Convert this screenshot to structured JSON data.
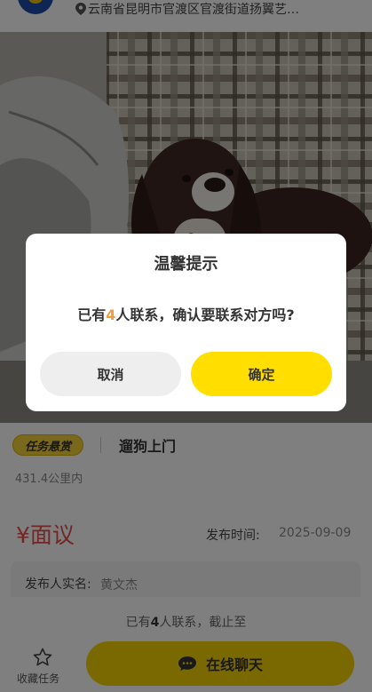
{
  "header": {
    "location": "云南省昆明市官渡区官渡街道扬翼艺…"
  },
  "task": {
    "badge": "任务悬赏",
    "title": "遛狗上门",
    "distance": "431.4公里内",
    "price": "¥面议",
    "publish_label": "发布时间:",
    "publish_time": "2025-09-09",
    "publisher_label": "发布人实名:",
    "publisher_name": "黄文杰"
  },
  "bottom_bar": {
    "contact_prefix": "已有",
    "contact_count": "4",
    "contact_suffix": "人联系，截止至",
    "favorite_label": "收藏任务",
    "chat_label": "在线聊天"
  },
  "dialog": {
    "title": "温馨提示",
    "msg_prefix": "已有",
    "msg_count": "4",
    "msg_suffix": "人联系，确认要联系对方吗?",
    "cancel_label": "取消",
    "confirm_label": "确定"
  },
  "colors": {
    "accent_yellow": "#ffde00",
    "price_red": "#e54d4d",
    "count_orange": "#f39a3a"
  }
}
